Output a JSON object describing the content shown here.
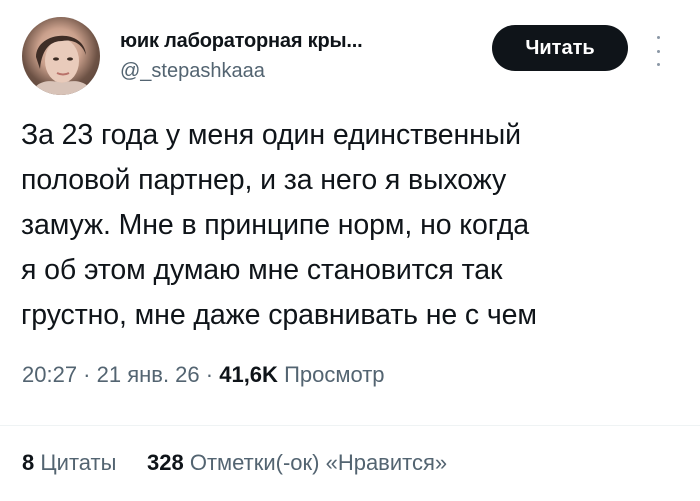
{
  "author": {
    "name": "юик лабораторная кры...",
    "handle": "@_stepashkaaa"
  },
  "follow_button": {
    "label": "Читать"
  },
  "tweet": {
    "lines": [
      "За 23 года у меня один единственный",
      "половой партнер, и за него я выхожу",
      "замуж. Мне в принципе норм, но когда",
      "я об этом думаю мне становится так",
      "грустно, мне даже сравнивать не с чем"
    ]
  },
  "meta": {
    "time": "20:27",
    "sep1": " · ",
    "date": "21 янв. 26",
    "sep2": " · ",
    "views_count": "41,6K",
    "views_label": "Просмотр"
  },
  "stats": {
    "quotes_count": "8",
    "quotes_label": "Цитаты",
    "likes_count": "328",
    "likes_label": "Отметки(-ок) «Нравится»"
  },
  "colors": {
    "text": "#0f1419",
    "secondary": "#536471",
    "button_bg": "#0f1419"
  },
  "icons": {
    "more": "more-vertical-icon"
  }
}
